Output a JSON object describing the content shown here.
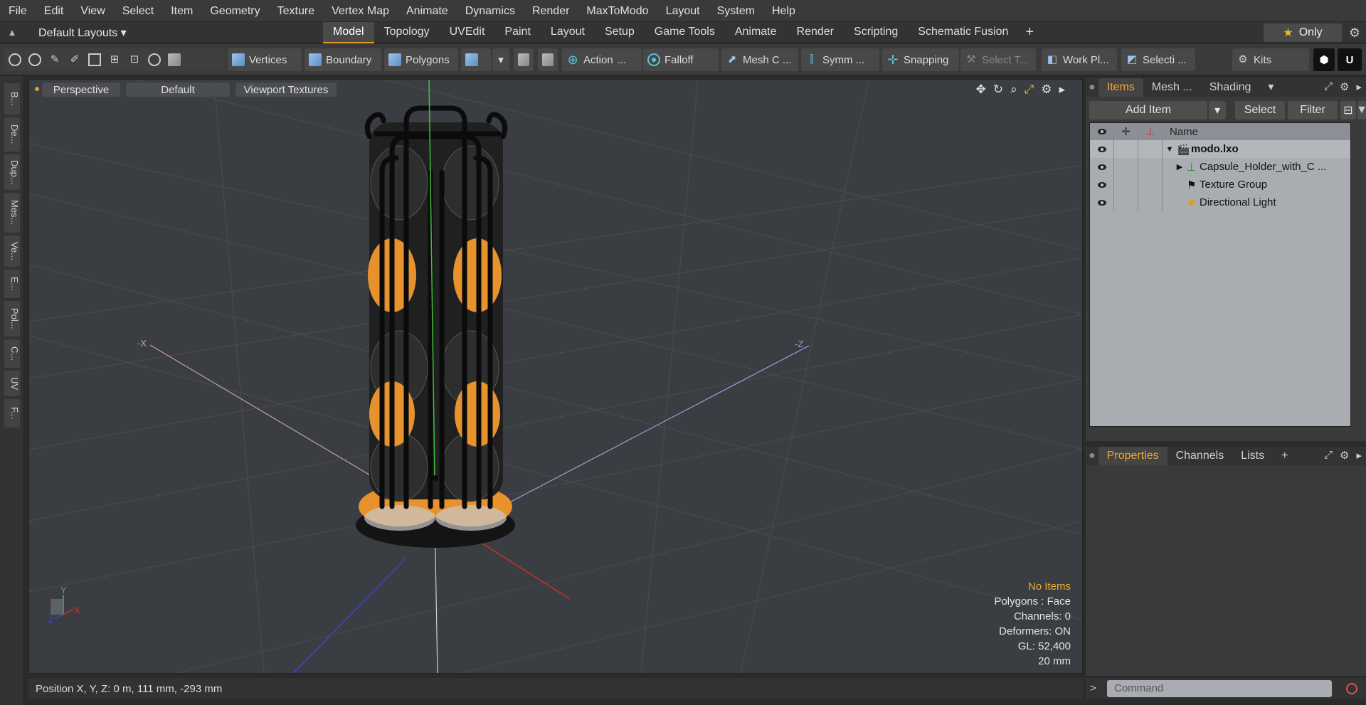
{
  "menu": [
    "File",
    "Edit",
    "View",
    "Select",
    "Item",
    "Geometry",
    "Texture",
    "Vertex Map",
    "Animate",
    "Dynamics",
    "Render",
    "MaxToModo",
    "Layout",
    "System",
    "Help"
  ],
  "layouts_label": "Default Layouts ▾",
  "layout_tabs": [
    "Model",
    "Topology",
    "UVEdit",
    "Paint",
    "Layout",
    "Setup",
    "Game Tools",
    "Animate",
    "Render",
    "Scripting",
    "Schematic Fusion"
  ],
  "active_layout_tab": "Model",
  "only_label": "Only",
  "toolbar": {
    "vertices": "Vertices",
    "boundary": "Boundary",
    "polygons": "Polygons",
    "action": "Action",
    "action_more": "...",
    "falloff": "Falloff",
    "mesh": "Mesh C ...",
    "symmetry": "Symm ...",
    "snapping": "Snapping",
    "select_tool": "Select T...",
    "workplane": "Work Pl...",
    "selection": "Selecti ...",
    "kits": "Kits"
  },
  "left_strip": [
    "B...",
    "De...",
    "Dup...",
    "Mes...",
    "Ve...",
    "E...",
    "Pol...",
    "C...",
    "UV",
    "F..."
  ],
  "viewport": {
    "view_mode": "Perspective",
    "shading": "Default",
    "textures": "Viewport Textures",
    "axis_labels": {
      "x_neg": "-X",
      "z_neg": "-Z",
      "x": "X",
      "y": "Y",
      "z": "Z"
    },
    "stats": {
      "selection": "No Items",
      "polygons": "Polygons : Face",
      "channels": "Channels: 0",
      "deformers": "Deformers: ON",
      "gl": "GL: 52,400",
      "grid": "20 mm"
    },
    "colors": {
      "orange": "#e8922e",
      "selection": "#f0b02a"
    }
  },
  "status": {
    "position": "Position X, Y, Z:   0 m, 111 mm, -293 mm"
  },
  "items_panel": {
    "tabs": [
      "Items",
      "Mesh ...",
      "Shading"
    ],
    "add_item": "Add Item",
    "select": "Select",
    "filter": "Filter",
    "col_name": "Name",
    "rows": [
      {
        "label": "modo.lxo",
        "bold": true
      },
      {
        "label": "Capsule_Holder_with_C ...",
        "bold": false
      },
      {
        "label": "Texture Group",
        "bold": false
      },
      {
        "label": "Directional Light",
        "bold": false
      }
    ]
  },
  "properties_panel": {
    "tabs": [
      "Properties",
      "Channels",
      "Lists"
    ]
  },
  "command": {
    "placeholder": "Command"
  }
}
